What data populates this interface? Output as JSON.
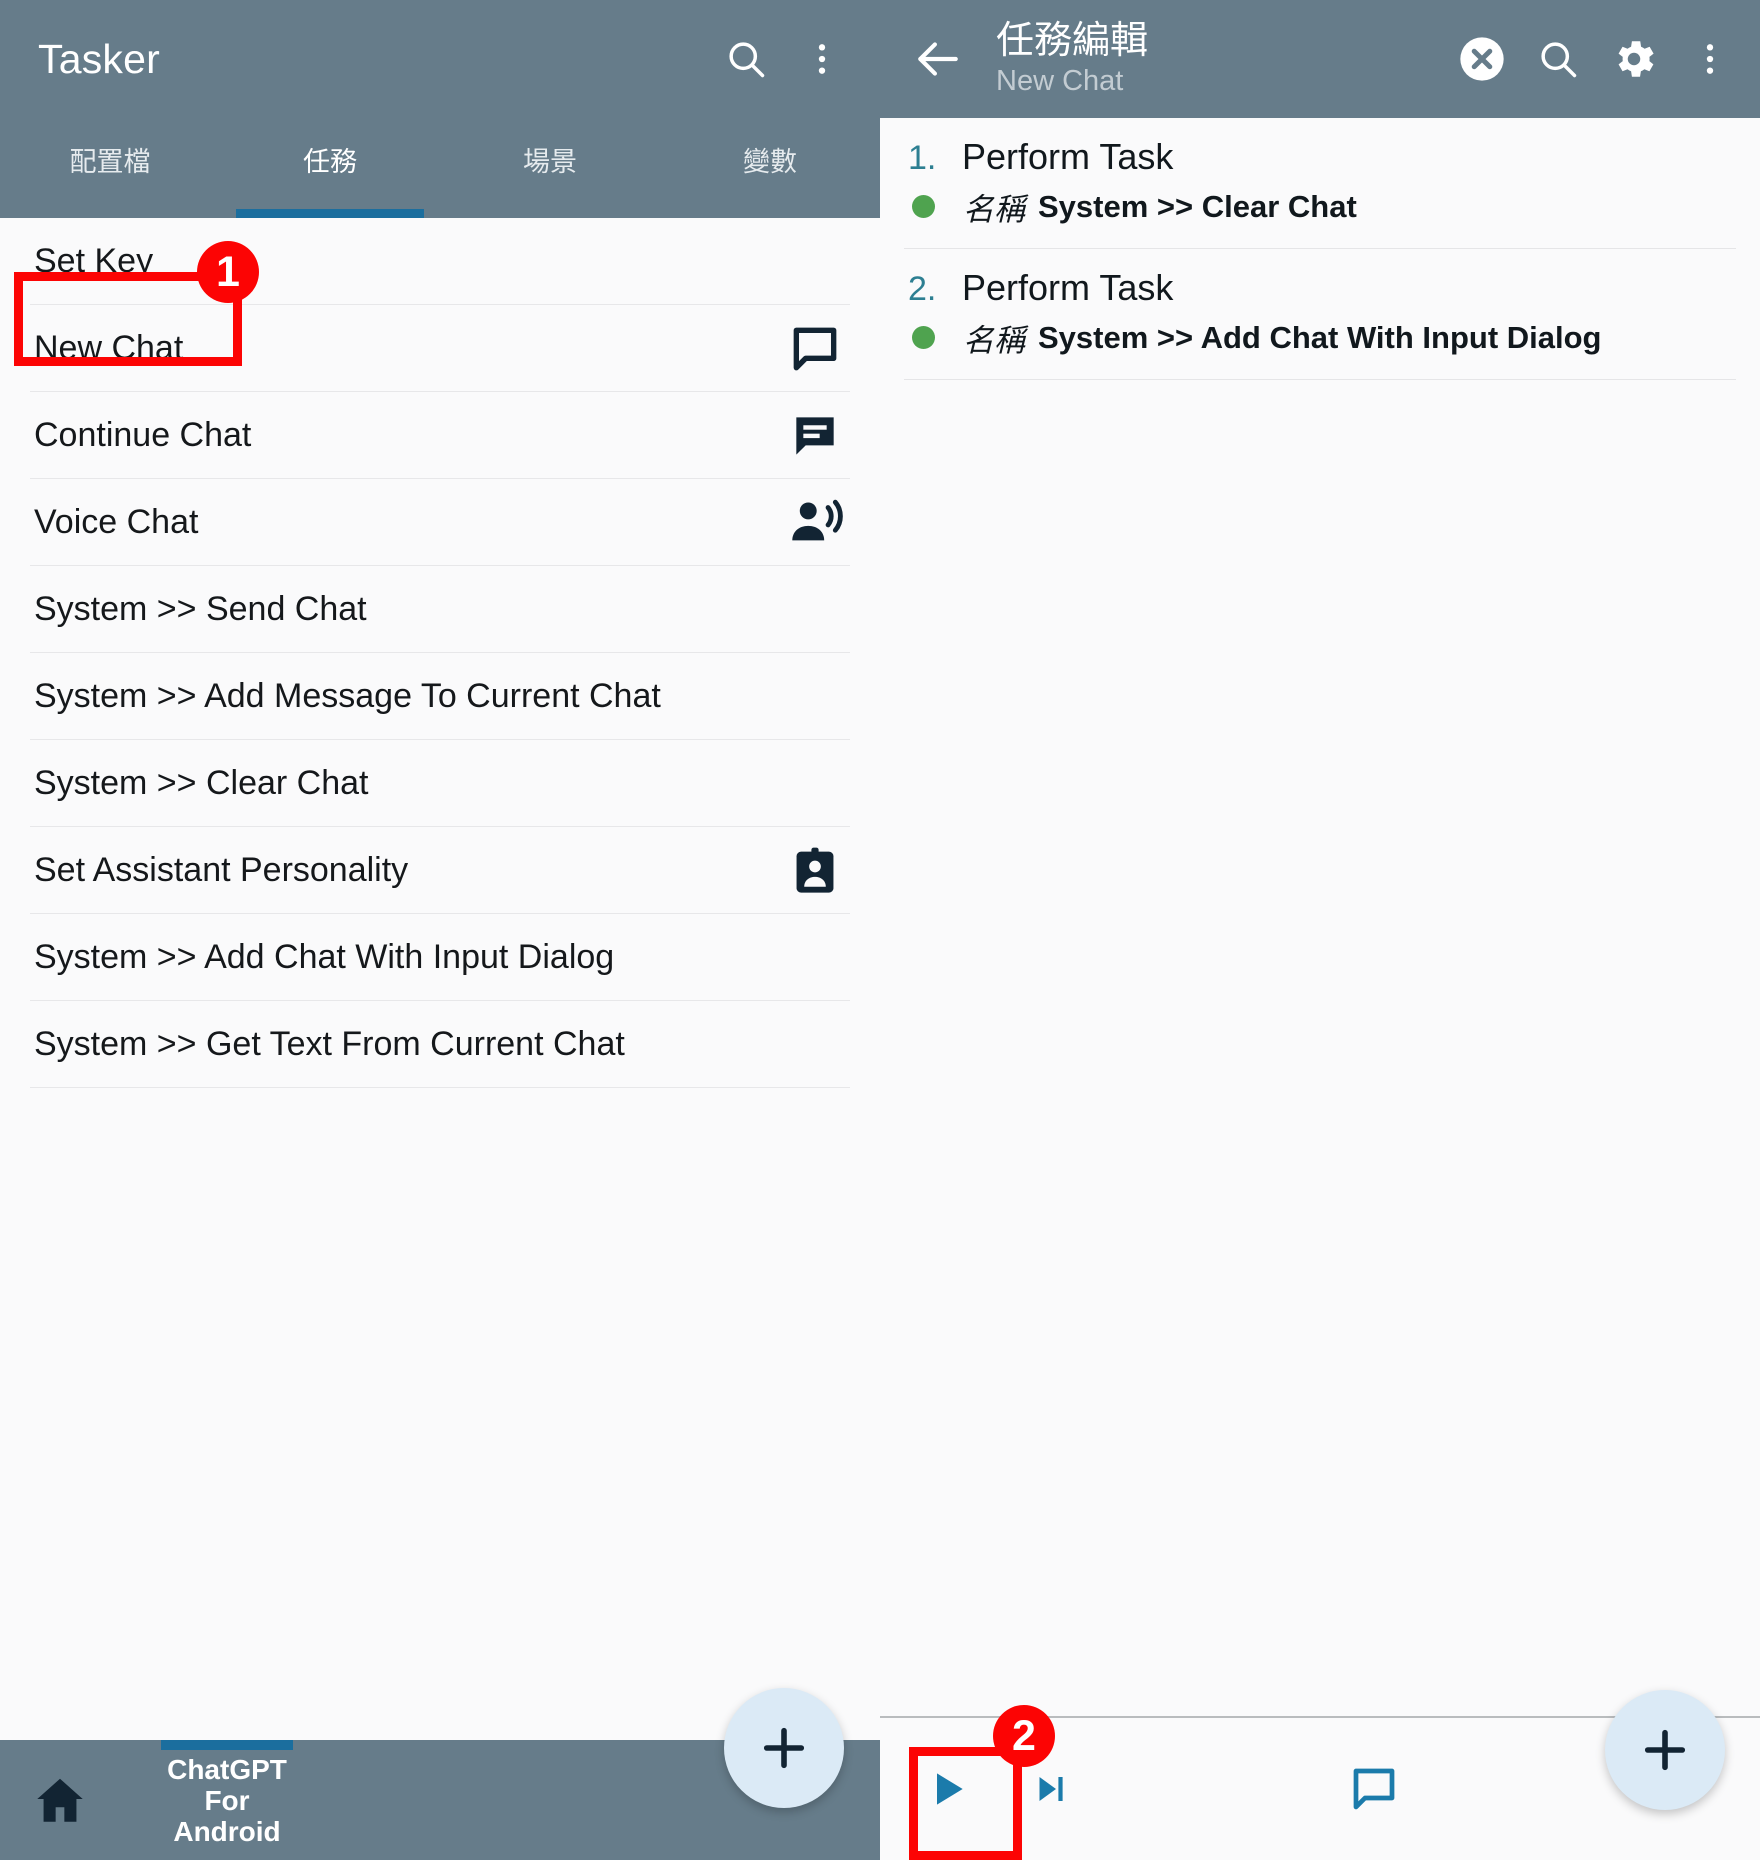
{
  "left_panel": {
    "app_title": "Tasker",
    "appbar_icons": [
      "search-icon",
      "overflow-menu-icon"
    ],
    "tabs": [
      {
        "label": "配置檔",
        "active": false
      },
      {
        "label": "任務",
        "active": true
      },
      {
        "label": "場景",
        "active": false
      },
      {
        "label": "變數",
        "active": false
      }
    ],
    "tasks": [
      {
        "label": "Set Key",
        "icon": ""
      },
      {
        "label": "New Chat",
        "icon": "chat-bubble-outline-icon"
      },
      {
        "label": "Continue Chat",
        "icon": "chat-bubble-lines-icon"
      },
      {
        "label": "Voice Chat",
        "icon": "person-speaking-icon"
      },
      {
        "label": "System >> Send Chat",
        "icon": ""
      },
      {
        "label": "System >> Add Message To Current Chat",
        "icon": ""
      },
      {
        "label": "System >> Clear Chat",
        "icon": ""
      },
      {
        "label": "Set Assistant Personality",
        "icon": "id-badge-icon"
      },
      {
        "label": "System >> Add Chat With Input Dialog",
        "icon": ""
      },
      {
        "label": "System >> Get Text From Current Chat",
        "icon": ""
      }
    ],
    "fab_label": "+",
    "bottom_bar": {
      "home_icon": "home-icon",
      "promo_line1": "ChatGPT",
      "promo_line2": "For",
      "promo_line3": "Android"
    }
  },
  "right_panel": {
    "title": "任務編輯",
    "subtitle": "New Chat",
    "appbar_icons": [
      "close-circle-icon",
      "search-icon",
      "gear-icon",
      "overflow-menu-icon"
    ],
    "actions": [
      {
        "number": "1.",
        "name": "Perform Task",
        "param_label": "名稱",
        "param_value": "System >> Clear Chat",
        "status": "enabled"
      },
      {
        "number": "2.",
        "name": "Perform Task",
        "param_label": "名稱",
        "param_value": "System >> Add Chat With Input Dialog",
        "status": "enabled"
      }
    ],
    "bottom_bar": {
      "play_icon": "play-icon",
      "step_icon": "step-forward-icon",
      "chat_icon": "chat-bubble-outline-icon"
    },
    "fab_label": "+"
  },
  "annotations": [
    {
      "badge": "1",
      "target": "New Chat task row"
    },
    {
      "badge": "2",
      "target": "Play / run task button"
    }
  ],
  "colors": {
    "appbar": "#667c8a",
    "tab_indicator": "#1b6e9e",
    "annotation_red": "#fc0404",
    "action_number": "#2d7f92",
    "status_green": "#4fa34f",
    "fab_bg": "#dbeaf6",
    "accent_blue": "#1b7bab"
  }
}
